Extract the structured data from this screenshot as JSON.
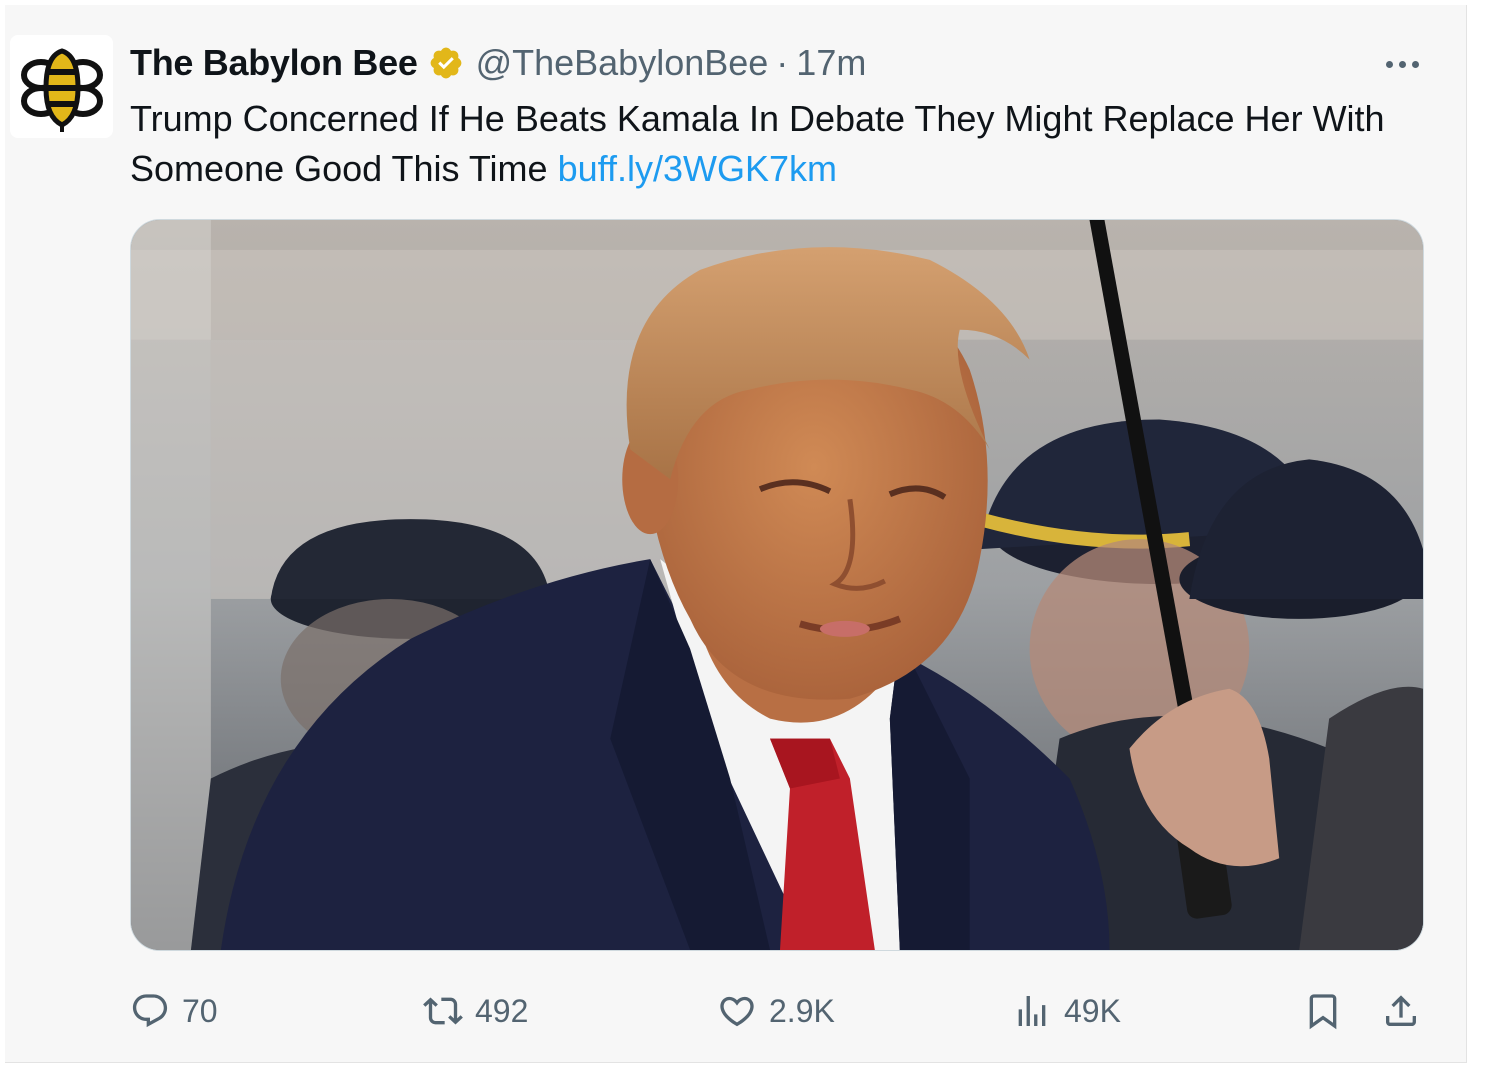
{
  "tweet": {
    "display_name": "The Babylon Bee",
    "verified": true,
    "handle": "@TheBabylonBee",
    "separator": "·",
    "time": "17m",
    "text": "Trump Concerned If He Beats Kamala In Debate They Might Replace Her With Someone Good This Time",
    "link": "buff.ly/3WGK7km"
  },
  "actions": {
    "replies": "70",
    "reposts": "492",
    "likes": "2.9K",
    "views": "49K"
  },
  "icons": {
    "avatar": "bee-logo-icon",
    "verified": "verified-badge-icon",
    "more": "more-icon",
    "reply": "reply-icon",
    "repost": "repost-icon",
    "like": "heart-icon",
    "views": "views-icon",
    "bookmark": "bookmark-icon",
    "share": "share-icon"
  },
  "colors": {
    "link": "#1d9bf0",
    "verified_badge": "#e2b719",
    "secondary_text": "#536471",
    "primary_text": "#0f1419"
  }
}
